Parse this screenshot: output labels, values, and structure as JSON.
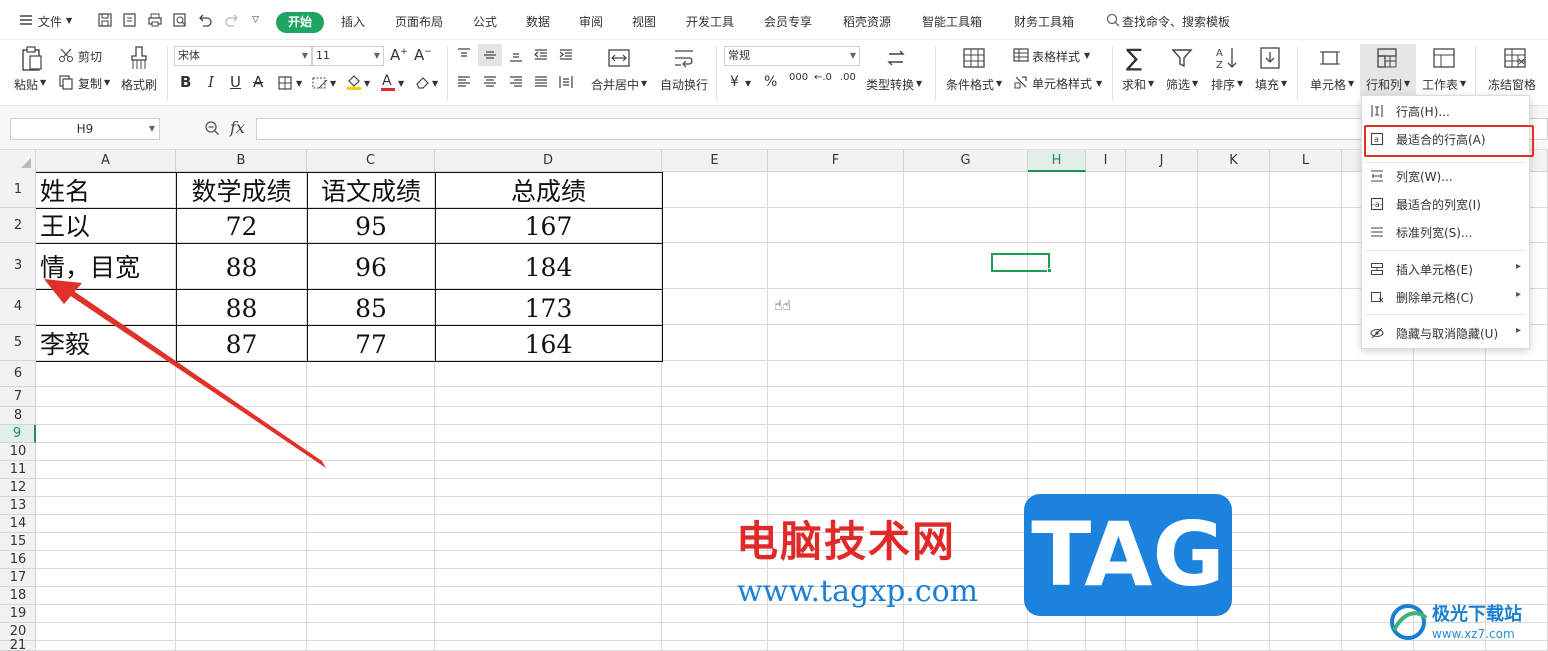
{
  "menubar": {
    "file": "文件",
    "tabs": [
      "开始",
      "插入",
      "页面布局",
      "公式",
      "数据",
      "审阅",
      "视图",
      "开发工具",
      "会员专享",
      "稻壳资源",
      "智能工具箱",
      "财务工具箱"
    ],
    "search": "查找命令、搜索模板"
  },
  "toolbar": {
    "paste": "粘贴",
    "cut": "剪切",
    "copy": "复制",
    "format_painter": "格式刷",
    "font_name": "宋体",
    "font_size": "11",
    "bold": "B",
    "italic": "I",
    "underline": "U",
    "merge_center": "合并居中",
    "wrap": "自动换行",
    "number_format": "常规",
    "currency": "¥",
    "percent": "%",
    "thousands": "000",
    "dec_inc": "←.0",
    "dec_dec": ".00",
    "type_convert": "类型转换",
    "cond_format": "条件格式",
    "table_style": "表格样式",
    "cell_style": "单元格样式",
    "sum": "求和",
    "filter": "筛选",
    "sort": "排序",
    "fill": "填充",
    "cell": "单元格",
    "row_col": "行和列",
    "worksheet": "工作表",
    "freeze": "冻结窗格"
  },
  "formula_bar": {
    "name_box": "H9",
    "fx": "fx",
    "value": ""
  },
  "columns": [
    "A",
    "B",
    "C",
    "D",
    "E",
    "F",
    "G",
    "H",
    "I",
    "J",
    "K",
    "L"
  ],
  "selected_column": "H",
  "rows": [
    "1",
    "2",
    "3",
    "4",
    "5",
    "6",
    "7",
    "8",
    "9",
    "10",
    "11",
    "12",
    "13",
    "14",
    "15",
    "16",
    "17",
    "18",
    "19",
    "20",
    "21"
  ],
  "selected_row": "9",
  "table": {
    "headers": [
      "姓名",
      "数学成绩",
      "语文成绩",
      "总成绩"
    ],
    "rows": [
      [
        "王以",
        "72",
        "95",
        "167"
      ],
      [
        "情，目宽",
        "88",
        "96",
        "184"
      ],
      [
        "",
        "88",
        "85",
        "173"
      ],
      [
        "李毅",
        "87",
        "77",
        "164"
      ]
    ]
  },
  "dropdown": {
    "items": [
      {
        "label": "行高(H)...",
        "icon": "row-height-icon",
        "submenu": false
      },
      {
        "label": "最适合的行高(A)",
        "icon": "autofit-row-icon",
        "submenu": false
      },
      {
        "label": "列宽(W)...",
        "icon": "col-width-icon",
        "submenu": false
      },
      {
        "label": "最适合的列宽(I)",
        "icon": "autofit-col-icon",
        "submenu": false
      },
      {
        "label": "标准列宽(S)...",
        "icon": "standard-width-icon",
        "submenu": false
      },
      {
        "label": "插入单元格(E)",
        "icon": "insert-cell-icon",
        "submenu": true
      },
      {
        "label": "删除单元格(C)",
        "icon": "delete-cell-icon",
        "submenu": true
      },
      {
        "label": "隐藏与取消隐藏(U)",
        "icon": "hide-unhide-icon",
        "submenu": true
      }
    ],
    "highlighted_index": 1
  },
  "watermark": {
    "cn": "电脑技术网",
    "url": "www.tagxp.com",
    "tag": "TAG",
    "logo_cn": "极光下载站",
    "logo_url": "www.xz7.com"
  },
  "colors": {
    "accent": "#1fa463",
    "highlight_box": "#e0302a",
    "annotation_arrow": "#e0302a",
    "watermark_blue": "#1b82de"
  }
}
